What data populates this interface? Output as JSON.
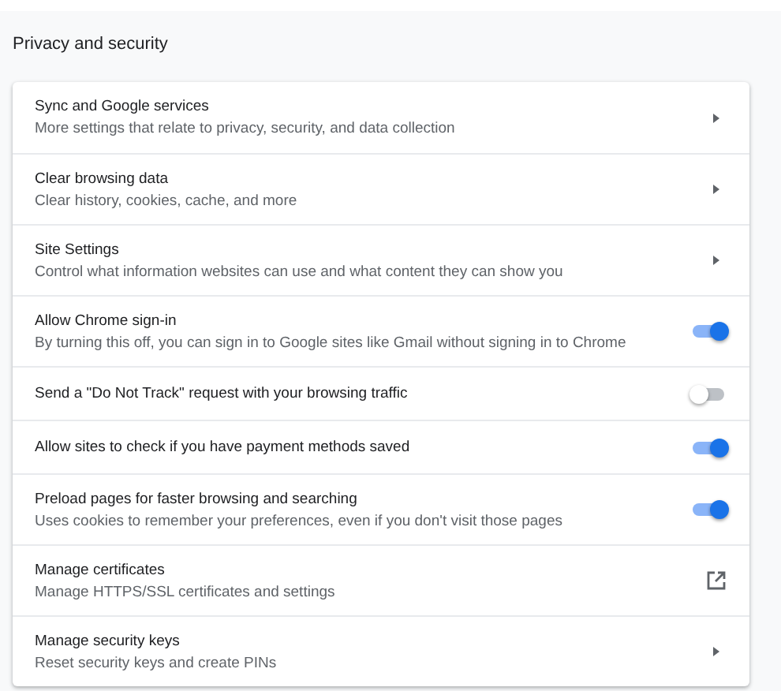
{
  "section_title": "Privacy and security",
  "rows": [
    {
      "kind": "arrow",
      "title": "Sync and Google services",
      "subtitle": "More settings that relate to privacy, security, and data collection"
    },
    {
      "kind": "arrow",
      "title": "Clear browsing data",
      "subtitle": "Clear history, cookies, cache, and more"
    },
    {
      "kind": "arrow",
      "title": "Site Settings",
      "subtitle": "Control what information websites can use and what content they can show you"
    },
    {
      "kind": "toggle",
      "title": "Allow Chrome sign-in",
      "subtitle": "By turning this off, you can sign in to Google sites like Gmail without signing in to Chrome",
      "on": true
    },
    {
      "kind": "toggle",
      "title": "Send a \"Do Not Track\" request with your browsing traffic",
      "on": false
    },
    {
      "kind": "toggle",
      "title": "Allow sites to check if you have payment methods saved",
      "on": true
    },
    {
      "kind": "toggle",
      "title": "Preload pages for faster browsing and searching",
      "subtitle": "Uses cookies to remember your preferences, even if you don't visit those pages",
      "on": true
    },
    {
      "kind": "external",
      "title": "Manage certificates",
      "subtitle": "Manage HTTPS/SSL certificates and settings"
    },
    {
      "kind": "arrow",
      "title": "Manage security keys",
      "subtitle": "Reset security keys and create PINs"
    }
  ]
}
